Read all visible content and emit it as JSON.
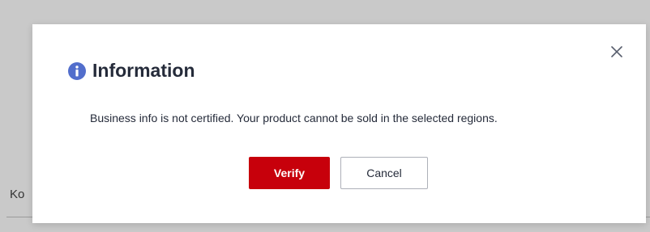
{
  "background": {
    "partial_text": "Ko"
  },
  "dialog": {
    "title": "Information",
    "message": "Business info is not certified. Your product cannot be sold in the selected regions.",
    "primary_button": "Verify",
    "secondary_button": "Cancel",
    "icons": {
      "info": "info-icon",
      "close": "close-icon"
    },
    "colors": {
      "primary": "#c7000b",
      "info_icon": "#526ecc",
      "text": "#252b3a"
    }
  }
}
